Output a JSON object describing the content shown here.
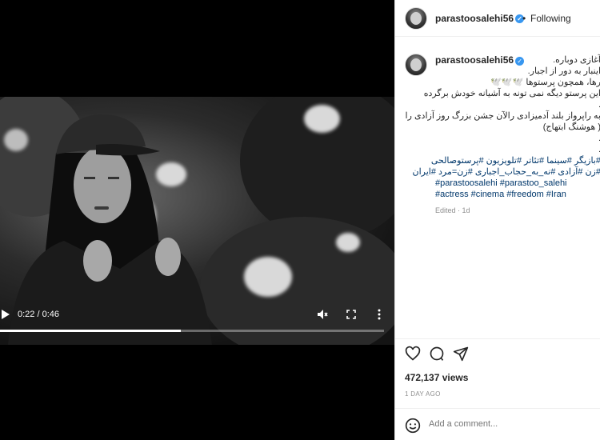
{
  "video": {
    "time_current": "0:22",
    "time_separator": "/",
    "time_total": "0:46",
    "progress_fraction": 0.47
  },
  "header": {
    "username": "parastoosalehi56",
    "separator": "•",
    "follow_label": "Following"
  },
  "caption": {
    "username": "parastoosalehi56",
    "lines": [
      "آغازی دوباره.",
      "اینبار به دور از اجبار.",
      "رها، همچون پرستوها 🕊️🕊️🕊️",
      "این پرستو دیگه نمی تونه به آشیانه خودش برگرده",
      ".",
      "به راپرواز بلند آدمیزادی رالآن جشن بزرگ روز آزادی را",
      "( هوشنگ ابتهاج)",
      ".",
      "."
    ],
    "hashtag_lines_rtl": [
      "#بازیگر #سینما #تئاتر #تلویزیون #پرستوصالحی",
      "#زن #آزادی #نه_به_حجاب_اجباری #زن=مرد #ایران"
    ],
    "hashtag_lines_ltr": [
      "#parastoosalehi #parastoo_salehi",
      "#actress #cinema #freedom #Iran"
    ],
    "edited": "Edited · 1d"
  },
  "stats": {
    "views": "472,137 views",
    "time_ago": "1 DAY AGO"
  },
  "comment": {
    "placeholder": "Add a comment..."
  },
  "colors": {
    "accent_verified": "#3897f0",
    "hashtag": "#00376b",
    "muted": "#8e8e8e"
  },
  "icons": [
    "play-icon",
    "mute-icon",
    "fullscreen-icon",
    "more-icon",
    "heart-icon",
    "comment-icon",
    "share-icon",
    "emoji-icon",
    "verified-icon"
  ]
}
